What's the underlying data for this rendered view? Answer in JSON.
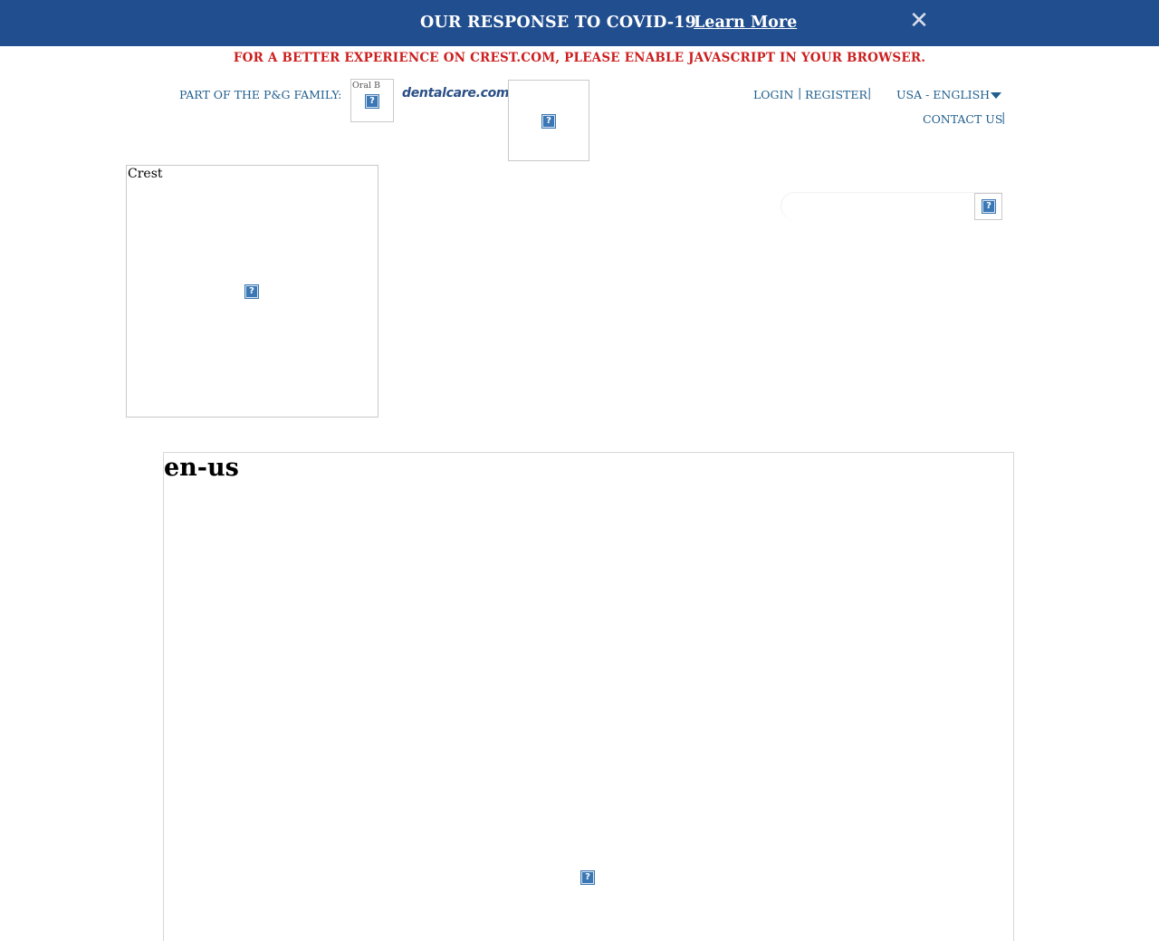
{
  "banner": {
    "message": "OUR RESPONSE TO COVID-19",
    "link_label": "Learn More",
    "close_glyph": "✕",
    "background_color": "#214e8f"
  },
  "js_notice": "FOR A BETTER EXPERIENCE ON CREST.COM, PLEASE ENABLE JAVASCRIPT IN YOUR BROWSER.",
  "header": {
    "family_label": "PART OF THE P&G FAMILY:",
    "family_brands": [
      {
        "alt": "Oral B",
        "icon": "broken-image-icon"
      },
      {
        "label": "dentalcare.com"
      },
      {
        "alt": "",
        "icon": "broken-image-icon"
      }
    ],
    "utility_links": {
      "login": "LOGIN",
      "register": "REGISTER",
      "separator": "|",
      "language": "USA - ENGLISH",
      "contact": "CONTACT US"
    },
    "logo_alt": "Crest",
    "search": {
      "placeholder": "",
      "button_icon": "broken-image-icon"
    }
  },
  "main": {
    "locale_heading": "en-us",
    "image_icon": "broken-image-icon"
  },
  "colors": {
    "link": "#1f5e8e",
    "notice": "#cc1f1f",
    "broken_image": "#3a77b4"
  }
}
